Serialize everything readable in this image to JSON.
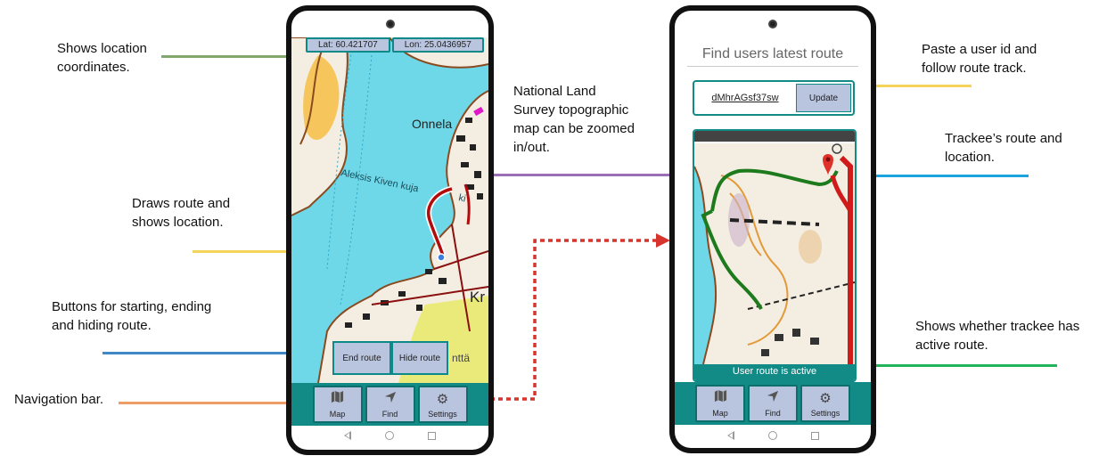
{
  "annotations": {
    "location_coordinates": [
      "Shows location",
      "coordinates."
    ],
    "draws_route": [
      "Draws route and",
      "shows location."
    ],
    "buttons_route": [
      "Buttons for starting, ending",
      "and hiding route."
    ],
    "navigation_bar": "Navigation bar.",
    "national_land_survey": [
      "National Land",
      "Survey topographic",
      "map can be zoomed",
      "in/out."
    ],
    "paste_user_id": [
      "Paste a user id and",
      "follow route track."
    ],
    "trackee_route": [
      "Trackee’s route and",
      "location."
    ],
    "active_route": [
      "Shows whether trackee has",
      "active route."
    ]
  },
  "annotation_colors": {
    "green": "#7fa86a",
    "yellow": "#f6d35a",
    "blue": "#3f87c5",
    "orange": "#ee9d66",
    "purple": "#9b6fb6",
    "cyan": "#1aa3dd",
    "bright_green": "#22b45a",
    "red_dotted": "#d6342c"
  },
  "phone1": {
    "lat": "Lat: 60.421707",
    "lon": "Lon: 25.0436957",
    "map_labels": {
      "onnela": "Onnela",
      "street": "Aleksis Kiven kuja",
      "street_suffix": "ki",
      "kr": "Kr",
      "ntta": "nttä"
    },
    "end_route": "End route",
    "hide_route": "Hide route",
    "nav": [
      {
        "label": "Map",
        "icon": "map-icon"
      },
      {
        "label": "Find",
        "icon": "navigation-arrow-icon"
      },
      {
        "label": "Settings",
        "icon": "gear-icon"
      }
    ]
  },
  "phone2": {
    "title": "Find users latest route",
    "user_id": "dMhrAGsf37sw",
    "update": "Update",
    "status": "User route is active",
    "nav": [
      {
        "label": "Map",
        "icon": "map-icon"
      },
      {
        "label": "Find",
        "icon": "navigation-arrow-icon"
      },
      {
        "label": "Settings",
        "icon": "gear-icon"
      }
    ]
  }
}
